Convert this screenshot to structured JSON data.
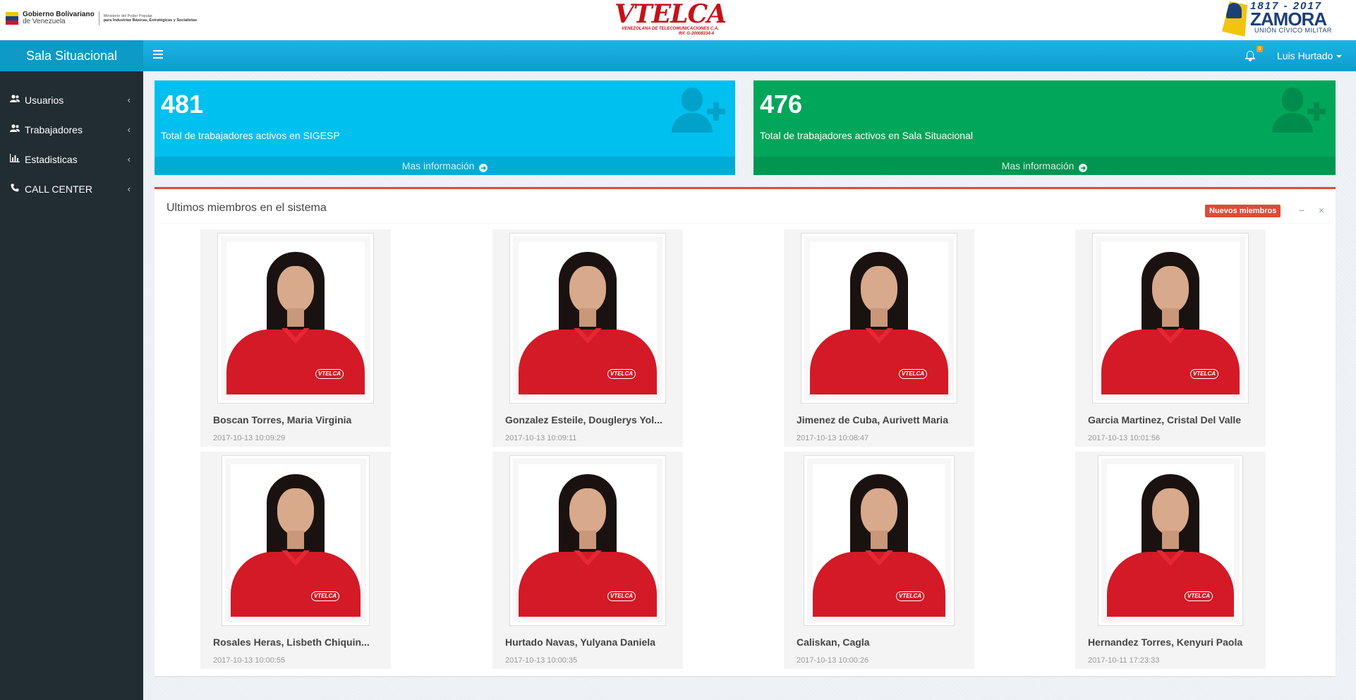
{
  "banner": {
    "gov_line1": "Gobierno Bolivariano",
    "gov_line2": "de Venezuela",
    "ministry_line1": "Ministerio del Poder Popular",
    "ministry_line2": "para Industrias Básicas, Estratégicas y Socialistas",
    "vtelca_name": "VTELCA",
    "vtelca_sub": "VENEZOLANA DE TELECOMUNICACIONES C.A.",
    "vtelca_rif": "Rif. G-20008334-4",
    "zamora_years": "1817 - 2017",
    "zamora_name": "ZAMORA",
    "zamora_sub": "UNIÓN CÍVICO MILITAR"
  },
  "header": {
    "app_title": "Sala Situacional",
    "notifications_count": "0",
    "user_name": "Luis Hurtado"
  },
  "sidebar": {
    "items": [
      {
        "label": "Usuarios",
        "icon": "users-icon"
      },
      {
        "label": "Trabajadores",
        "icon": "users-icon"
      },
      {
        "label": "Estadisticas",
        "icon": "bar-chart-icon"
      },
      {
        "label": "CALL CENTER",
        "icon": "phone-icon"
      }
    ]
  },
  "stats": [
    {
      "value": "481",
      "text": "Total de trabajadores activos en SIGESP",
      "link": "Mas información",
      "color": "#00c0ef"
    },
    {
      "value": "476",
      "text": "Total de trabajadores activos en Sala Situacional",
      "link": "Mas información",
      "color": "#00a65a"
    }
  ],
  "members_box": {
    "title": "Ultimos miembros en el sistema",
    "badge": "Nuevos miembros",
    "members": [
      {
        "name": "Boscan Torres, Maria Virginia",
        "date": "2017-10-13 10:09:29"
      },
      {
        "name": "Gonzalez Esteile, Douglerys Yol...",
        "date": "2017-10-13 10:09:11"
      },
      {
        "name": "Jimenez de Cuba, Aurivett Maria",
        "date": "2017-10-13 10:08:47"
      },
      {
        "name": "Garcia Martinez, Cristal Del Valle",
        "date": "2017-10-13 10:01:56"
      },
      {
        "name": "Rosales Heras, Lisbeth Chiquin...",
        "date": "2017-10-13 10:00:55"
      },
      {
        "name": "Hurtado Navas, Yulyana Daniela",
        "date": "2017-10-13 10:00:35"
      },
      {
        "name": "Caliskan, Cagla",
        "date": "2017-10-13 10:00:26"
      },
      {
        "name": "Hernandez Torres, Kenyuri Paola",
        "date": "2017-10-11 17:23:33"
      }
    ]
  }
}
